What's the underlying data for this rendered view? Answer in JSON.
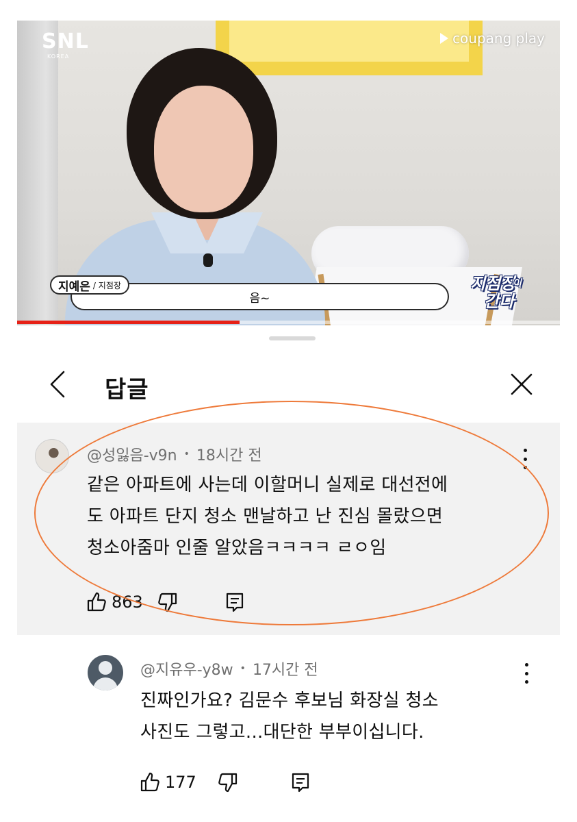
{
  "video": {
    "brand_logo": "SNL",
    "brand_logo_sub": "KOREA",
    "platform_logo": "coupang play",
    "name_tag": {
      "name": "지예은",
      "role": "/ 지점장"
    },
    "caption": "음~",
    "show_logo_line1": "지점장",
    "show_logo_small": "이",
    "show_logo_line2": "간다",
    "progress": 0.41,
    "colors": {
      "progress": "#e62117"
    }
  },
  "sheet": {
    "title": "답글",
    "back_icon": "chevron-left-icon",
    "close_icon": "close-icon"
  },
  "comments": [
    {
      "author": "@성잃음-v9n",
      "separator": "•",
      "time": "18시간 전",
      "lines": [
        "같은 아파트에 사는데 이할머니 실제로 대선전에",
        "도 아파트 단지 청소 맨날하고 난 진심 몰랐으면",
        "청소아줌마 인줄 알았음ㅋㅋㅋㅋ ㄹㅇ임"
      ],
      "likes": "863",
      "highlighted": true
    },
    {
      "author": "@지유우-y8w",
      "separator": "•",
      "time": "17시간 전",
      "lines": [
        "진짜인가요? 김문수 후보님 화장실 청소",
        "사진도 그렇고...대단한 부부이십니다."
      ],
      "likes": "177",
      "highlighted": false
    }
  ],
  "colors": {
    "highlight": "#ee7a3a",
    "comment_bg": "#f2f2f2",
    "meta_text": "#6f6f6f"
  }
}
